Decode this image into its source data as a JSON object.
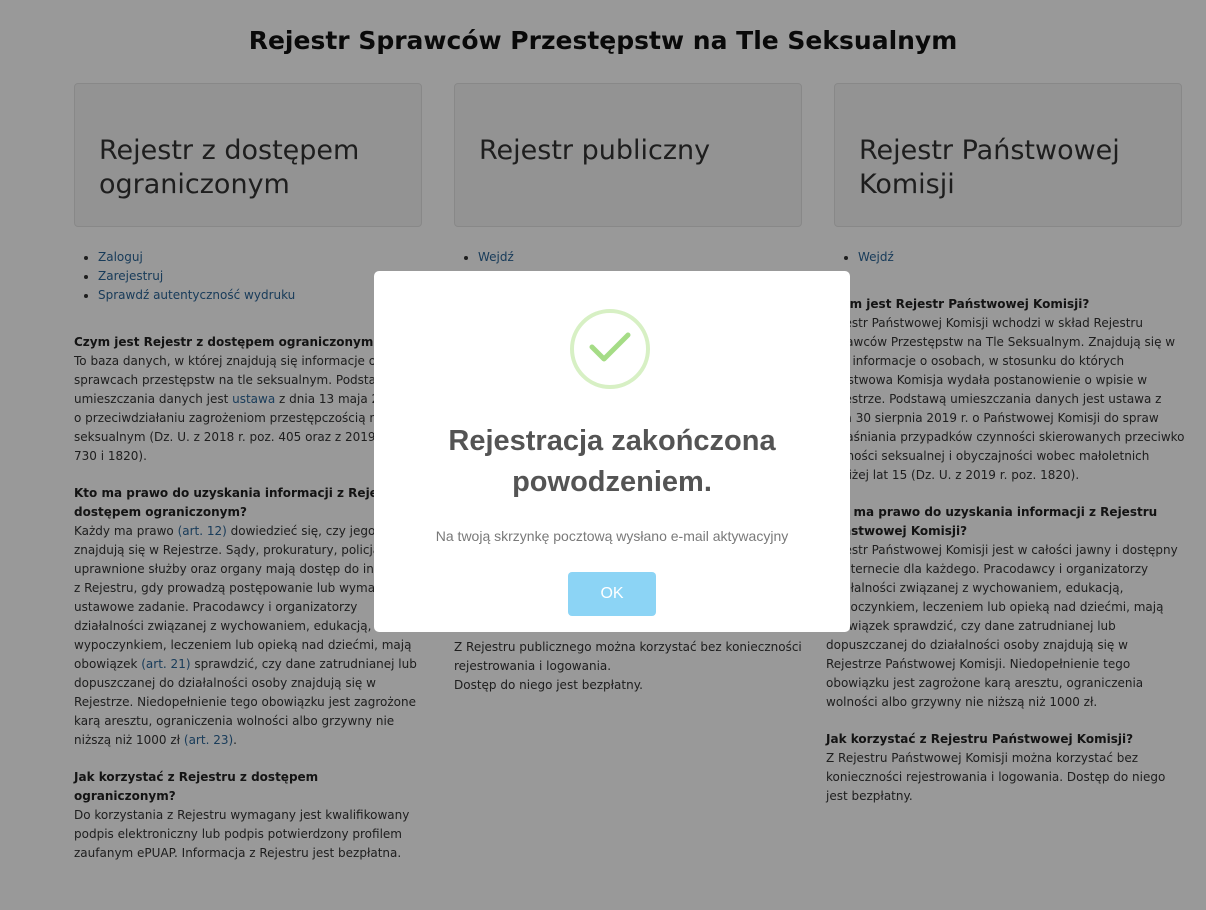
{
  "page": {
    "title": "Rejestr Sprawców Przestępstw na Tle Seksualnym"
  },
  "cards": [
    {
      "title": "Rejestr z dostępem ograniczonym"
    },
    {
      "title": "Rejestr publiczny"
    },
    {
      "title": "Rejestr Państwowej Komisji"
    }
  ],
  "col1": {
    "links": [
      "Zaloguj",
      "Zarejestruj",
      "Sprawdź autentyczność wydruku"
    ],
    "q1": "Czym jest Rejestr z dostępem ograniczonym?",
    "a1_pre": "To baza danych, w której znajdują się informacje o sprawcach przestępstw na tle seksualnym. Podstawą umieszczania danych jest ",
    "a1_link": "ustawa",
    "a1_post": " z dnia 13 maja 2016 r. o przeciwdziałaniu zagrożeniom przestępczością na tle seksualnym (Dz. U. z 2018 r. poz. 405 oraz z 2019 r. poz. 730 i 1820).",
    "q2": "Kto ma prawo do uzyskania informacji z Rejestru z dostępem ograniczonym?",
    "a2_pre": "Każdy ma prawo ",
    "a2_link1": "(art. 12)",
    "a2_mid": " dowiedzieć się, czy jego dane znajdują się w Rejestrze. Sądy, prokuratury, policja i inne uprawnione służby oraz organy mają dostęp do informacji z Rejestru, gdy prowadzą postępowanie lub wymaga tego ustawowe zadanie. Pracodawcy i organizatorzy działalności związanej z wychowaniem, edukacją, wypoczynkiem, leczeniem lub opieką nad dziećmi, mają obowiązek ",
    "a2_link2": "(art. 21)",
    "a2_mid2": " sprawdzić, czy dane zatrudnianej lub dopuszczanej do działalności osoby znajdują się w Rejestrze. Niedopełnienie tego obowiązku jest zagrożone karą aresztu, ograniczenia wolności albo grzywny nie niższą niż 1000 zł ",
    "a2_link3": "(art. 23)",
    "a2_end": ".",
    "q3": "Jak korzystać z Rejestru z dostępem ograniczonym?",
    "a3": "Do korzystania z Rejestru wymagany jest kwalifikowany podpis elektroniczny lub podpis potwierdzony profilem zaufanym ePUAP. Informacja z Rejestru jest bezpłatna."
  },
  "col2": {
    "links": [
      "Wejdź"
    ],
    "a1": "Z Rejestru publicznego można korzystać bez konieczności rejestrowania i logowania.",
    "a2": "Dostęp do niego jest bezpłatny."
  },
  "col3": {
    "links": [
      "Wejdź"
    ],
    "q1": "Czym jest Rejestr Państwowej Komisji?",
    "a1": "Rejestr Państwowej Komisji wchodzi w skład Rejestru Sprawców Przestępstw na Tle Seksualnym. Znajdują się w nim informacje o osobach, w stosunku do których Państwowa Komisja wydała postanowienie o wpisie w Rejestrze. Podstawą umieszczania danych jest ustawa z dnia 30 sierpnia 2019 r. o Państwowej Komisji do spraw wyjaśniania przypadków czynności skierowanych przeciwko wolności seksualnej i obyczajności wobec małoletnich poniżej lat 15 (Dz. U. z 2019 r. poz. 1820).",
    "q2": "Kto ma prawo do uzyskania informacji z Rejestru Państwowej Komisji?",
    "a2": "Rejestr Państwowej Komisji jest w całości jawny i dostępny w internecie dla każdego. Pracodawcy i organizatorzy działalności związanej z wychowaniem, edukacją, wypoczynkiem, leczeniem lub opieką nad dziećmi, mają obowiązek sprawdzić, czy dane zatrudnianej lub dopuszczanej do działalności osoby znajdują się w Rejestrze Państwowej Komisji. Niedopełnienie tego obowiązku jest zagrożone karą aresztu, ograniczenia wolności albo grzywny nie niższą niż 1000 zł.",
    "q3": "Jak korzystać z Rejestru Państwowej Komisji?",
    "a3": "Z Rejestru Państwowej Komisji można korzystać bez konieczności rejestrowania i logowania. Dostęp do niego jest bezpłatny."
  },
  "modal": {
    "icon": "checkmark-icon",
    "title": "Rejestracja zakończona powodzeniem.",
    "message": "Na twoją skrzynkę pocztową wysłano e-mail aktywacyjny",
    "ok_label": "OK",
    "accent": "#8cd4f5",
    "success_color": "#a5dc86"
  }
}
